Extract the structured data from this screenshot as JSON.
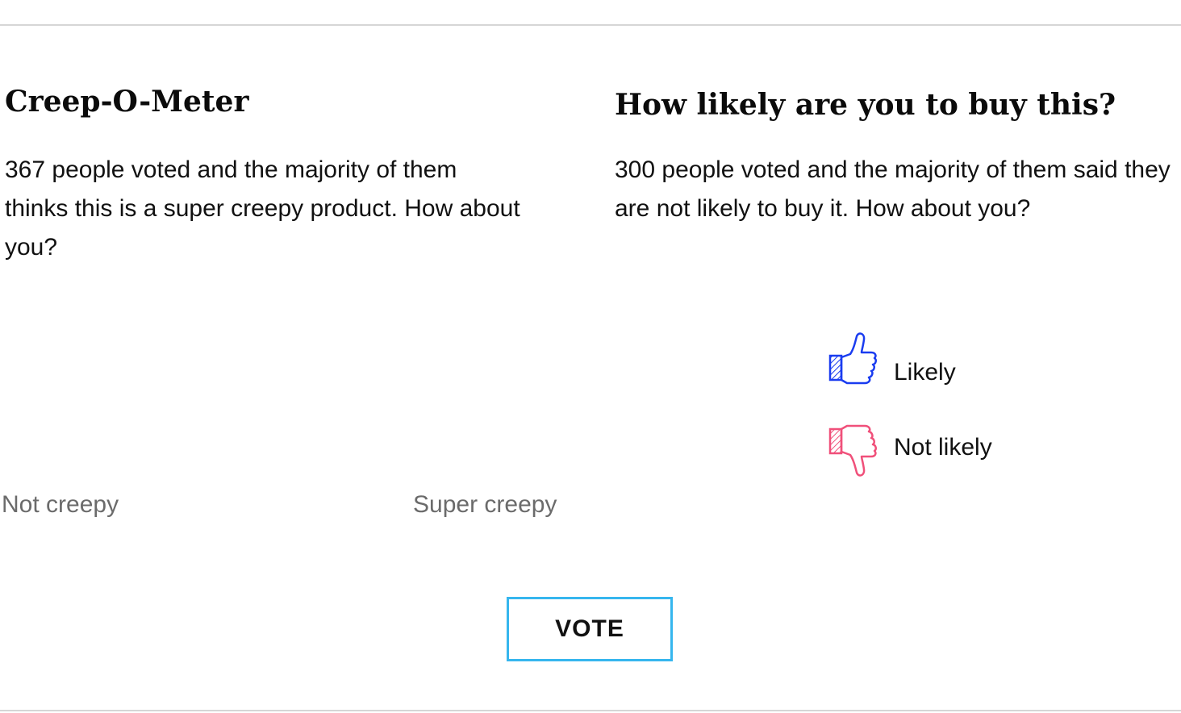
{
  "creep_meter": {
    "title": "Creep-O-Meter",
    "summary": "367 people voted and the majority of them thinks this is a super creepy product. How about you?",
    "scale_min_label": "Not creepy",
    "scale_max_label": "Super creepy"
  },
  "buy_poll": {
    "title": "How likely are you to buy this?",
    "summary": "300 people voted and the majority of them said they are not likely to buy it. How about you?",
    "options": [
      {
        "label": "Likely",
        "icon": "thumbs-up-icon",
        "color": "#1a3cf0"
      },
      {
        "label": "Not likely",
        "icon": "thumbs-down-icon",
        "color": "#f0507a"
      }
    ]
  },
  "vote_button": {
    "label": "VOTE",
    "border_color": "#36b6ee"
  },
  "colors": {
    "divider": "#d6d6d6",
    "muted_text": "#6b6b6b"
  }
}
